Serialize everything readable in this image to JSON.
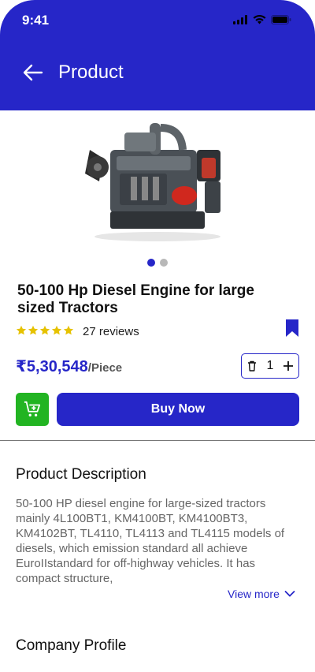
{
  "status_bar": {
    "time": "9:41"
  },
  "header": {
    "title": "Product"
  },
  "product": {
    "title": "50-100 Hp Diesel Engine for large sized Tractors",
    "rating": 5,
    "reviews": "27 reviews",
    "price": "₹5,30,548",
    "price_unit": "/Piece",
    "quantity": "1",
    "image_count": 2,
    "active_image": 1
  },
  "actions": {
    "buy_label": "Buy Now"
  },
  "description": {
    "title": "Product Description",
    "text": "50-100 HP diesel engine for large-sized tractors mainly 4L100BT1, KM4100BT, KM4100BT3, KM4102BT, TL4110, TL4113 and TL4115 models of diesels, which emission standard all  achieve EuroIIstandard for off-highway vehicles. It has compact structure,",
    "view_more": "View more"
  },
  "company": {
    "title": "Company Profile"
  },
  "colors": {
    "primary": "#2626c8",
    "cart": "#22b422",
    "star": "#e6c200"
  }
}
